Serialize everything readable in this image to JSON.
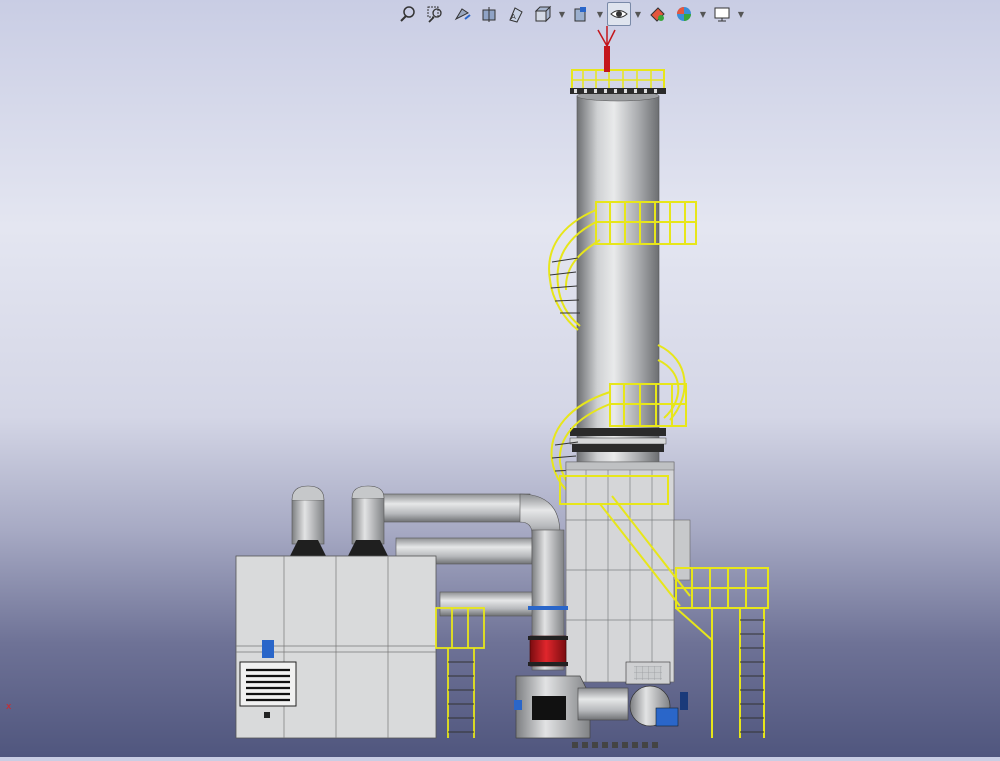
{
  "toolbar": {
    "buttons": [
      {
        "name": "zoom-to-fit",
        "icon": "zoom-fit-icon"
      },
      {
        "name": "zoom-to-area",
        "icon": "zoom-area-icon"
      },
      {
        "name": "previous-view",
        "icon": "previous-view-icon"
      },
      {
        "name": "section-view",
        "icon": "section-view-icon"
      },
      {
        "name": "dynamic-annotation-views",
        "icon": "annotation-views-icon"
      },
      {
        "name": "view-orientation",
        "icon": "view-orientation-icon",
        "dropdown": true
      },
      {
        "name": "display-style",
        "icon": "display-style-icon",
        "dropdown": true
      },
      {
        "name": "hide-show-items",
        "icon": "eye-icon",
        "dropdown": true,
        "active": true
      },
      {
        "name": "edit-appearance",
        "icon": "appearance-icon"
      },
      {
        "name": "apply-scene",
        "icon": "scene-icon",
        "dropdown": true
      },
      {
        "name": "view-settings",
        "icon": "monitor-icon",
        "dropdown": true
      }
    ]
  },
  "model": {
    "name": "exhaust-treatment-tower-assembly",
    "colors": {
      "steel": "#b9bcbf",
      "railing": "#e7e61a",
      "red_flange": "#c4161c",
      "blue_motor": "#2a66c9",
      "dark": "#1e1e1e"
    }
  },
  "triad": {
    "x_label": "x"
  }
}
